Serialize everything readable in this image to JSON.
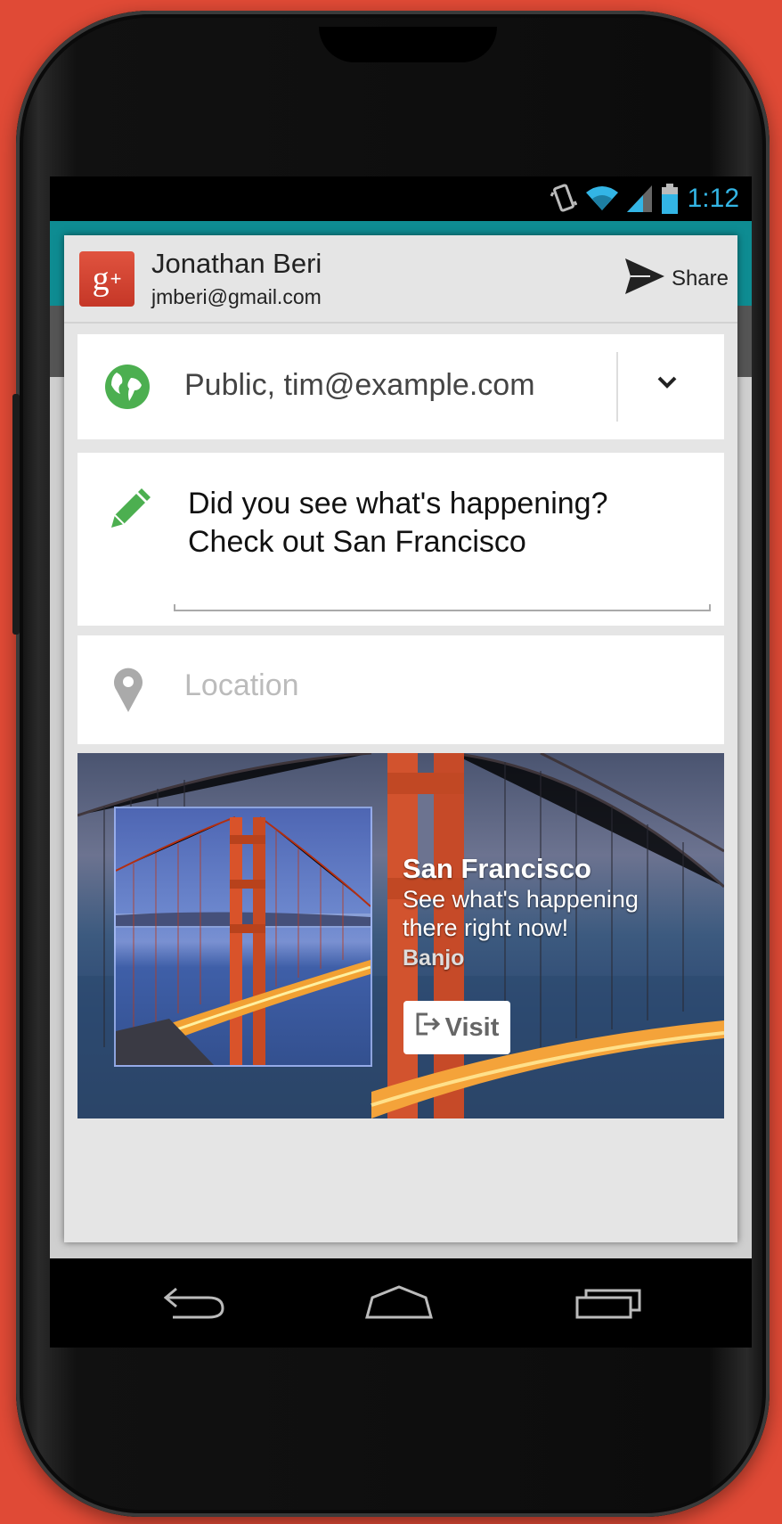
{
  "status_bar": {
    "time": "1:12",
    "icons": [
      "vibrate-icon",
      "wifi-icon",
      "signal-icon",
      "battery-icon"
    ],
    "color": "#33b5e5"
  },
  "header": {
    "logo_text": "g+",
    "user_name": "Jonathan Beri",
    "user_email": "jmberi@gmail.com",
    "share_label": "Share"
  },
  "audience": {
    "icon": "globe-icon",
    "text": "Public, tim@example.com",
    "accent": "#4caf50"
  },
  "message": {
    "icon": "pencil-icon",
    "text": "Did you see what's happening?\nCheck out San Francisco"
  },
  "location": {
    "icon": "pin-icon",
    "placeholder": "Location"
  },
  "link_preview": {
    "title": "San Francisco",
    "description": "See what's happening there right now!",
    "source": "Banjo",
    "visit_label": "Visit"
  },
  "nav": [
    "back-icon",
    "home-icon",
    "recent-apps-icon"
  ],
  "colors": {
    "background": "#e04a36",
    "gplus_red": "#d6412f",
    "app_teal": "#0e8c92"
  }
}
